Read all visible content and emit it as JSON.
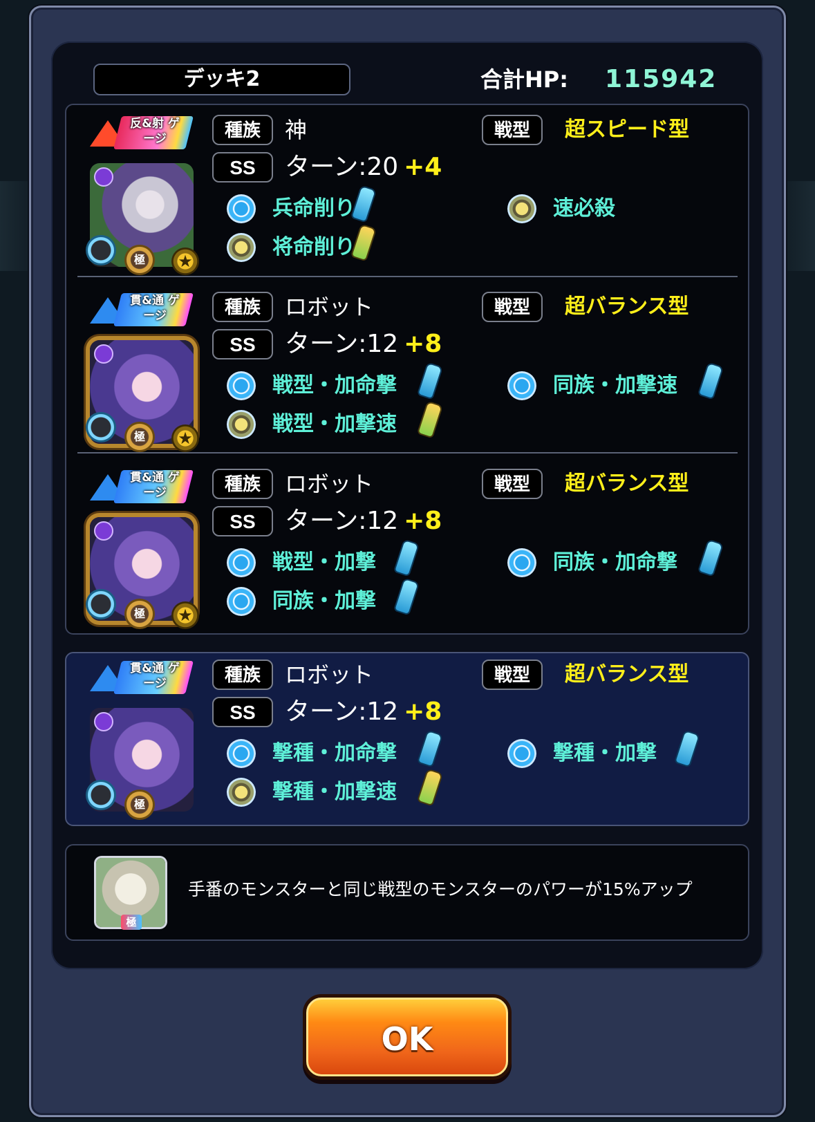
{
  "header": {
    "deck_name": "デッキ2",
    "hp_label": "合計HP:",
    "hp_value": "115942"
  },
  "units": [
    {
      "gauge": "反&射 ゲージ",
      "race_tag": "種族",
      "race": "神",
      "type_tag": "戦型",
      "type": "超スピード型",
      "ss_tag": "SS",
      "turn": "ターン:20",
      "turn_plus": "+4",
      "kyoku": "極",
      "abilities": [
        {
          "name": "兵命削り",
          "medal": "blue",
          "bottle": "blue"
        },
        {
          "name": "速必殺",
          "medal": "gold",
          "bottle": null
        },
        {
          "name": "将命削り",
          "medal": "gold",
          "bottle": "seed"
        }
      ]
    },
    {
      "gauge": "貫&通 ゲージ",
      "race_tag": "種族",
      "race": "ロボット",
      "type_tag": "戦型",
      "type": "超バランス型",
      "ss_tag": "SS",
      "turn": "ターン:12",
      "turn_plus": "+8",
      "kyoku": "極",
      "abilities": [
        {
          "name": "戦型・加命撃",
          "medal": "blue",
          "bottle": "blue"
        },
        {
          "name": "同族・加撃速",
          "medal": "blue",
          "bottle": "blue"
        },
        {
          "name": "戦型・加撃速",
          "medal": "gold",
          "bottle": "seed"
        }
      ]
    },
    {
      "gauge": "貫&通 ゲージ",
      "race_tag": "種族",
      "race": "ロボット",
      "type_tag": "戦型",
      "type": "超バランス型",
      "ss_tag": "SS",
      "turn": "ターン:12",
      "turn_plus": "+8",
      "kyoku": "極",
      "abilities": [
        {
          "name": "戦型・加撃",
          "medal": "blue",
          "bottle": "blue"
        },
        {
          "name": "同族・加命撃",
          "medal": "blue",
          "bottle": "blue"
        },
        {
          "name": "同族・加撃",
          "medal": "blue",
          "bottle": "blue"
        }
      ]
    },
    {
      "gauge": "貫&通 ゲージ",
      "race_tag": "種族",
      "race": "ロボット",
      "type_tag": "戦型",
      "type": "超バランス型",
      "ss_tag": "SS",
      "turn": "ターン:12",
      "turn_plus": "+8",
      "kyoku": "極",
      "abilities": [
        {
          "name": "撃種・加命撃",
          "medal": "blue",
          "bottle": "blue"
        },
        {
          "name": "撃種・加撃",
          "medal": "blue",
          "bottle": "blue"
        },
        {
          "name": "撃種・加撃速",
          "medal": "gold",
          "bottle": "seed"
        }
      ]
    }
  ],
  "leader": {
    "kyoku": "極",
    "text": "手番のモンスターと同じ戦型のモンスターのパワーが15%アップ"
  },
  "ok_button": "OK",
  "colors": {
    "hp_value": "#8ff5d6",
    "type_text": "#ffef1a",
    "ability_text": "#5ef0d8",
    "ok_button": "#f0661a"
  }
}
